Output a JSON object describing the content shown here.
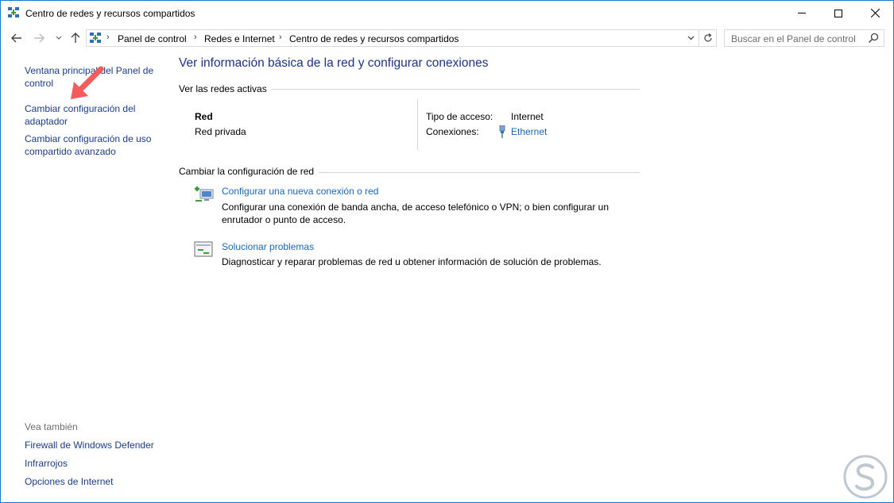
{
  "window": {
    "title": "Centro de redes y recursos compartidos"
  },
  "address": {
    "crumbs": [
      "Panel de control",
      "Redes e Internet",
      "Centro de redes y recursos compartidos"
    ],
    "search_placeholder": "Buscar en el Panel de control"
  },
  "left_pane": {
    "links": [
      "Ventana principal del Panel de control",
      "Cambiar configuración del adaptador",
      "Cambiar configuración de uso compartido avanzado"
    ],
    "see_also_heading": "Vea también",
    "see_also": [
      "Firewall de Windows Defender",
      "Infrarrojos",
      "Opciones de Internet"
    ]
  },
  "main": {
    "title": "Ver información básica de la red y configurar conexiones",
    "active_networks_label": "Ver las redes activas",
    "network": {
      "name": "Red",
      "type": "Red privada",
      "access_label": "Tipo de acceso:",
      "access_value": "Internet",
      "connections_label": "Conexiones:",
      "connection_value": "Ethernet"
    },
    "change_settings_label": "Cambiar la configuración de red",
    "tasks": [
      {
        "link": "Configurar una nueva conexión o red",
        "description": "Configurar una conexión de banda ancha, de acceso telefónico o VPN; o bien configurar un enrutador o punto de acceso."
      },
      {
        "link": "Solucionar problemas",
        "description": "Diagnosticar y reparar problemas de red u obtener información de solución de problemas."
      }
    ]
  },
  "colors": {
    "link": "#1a66b3",
    "nav_link": "#1b3c86",
    "title": "#1e3287",
    "annotation_arrow": "#f25c5c"
  }
}
